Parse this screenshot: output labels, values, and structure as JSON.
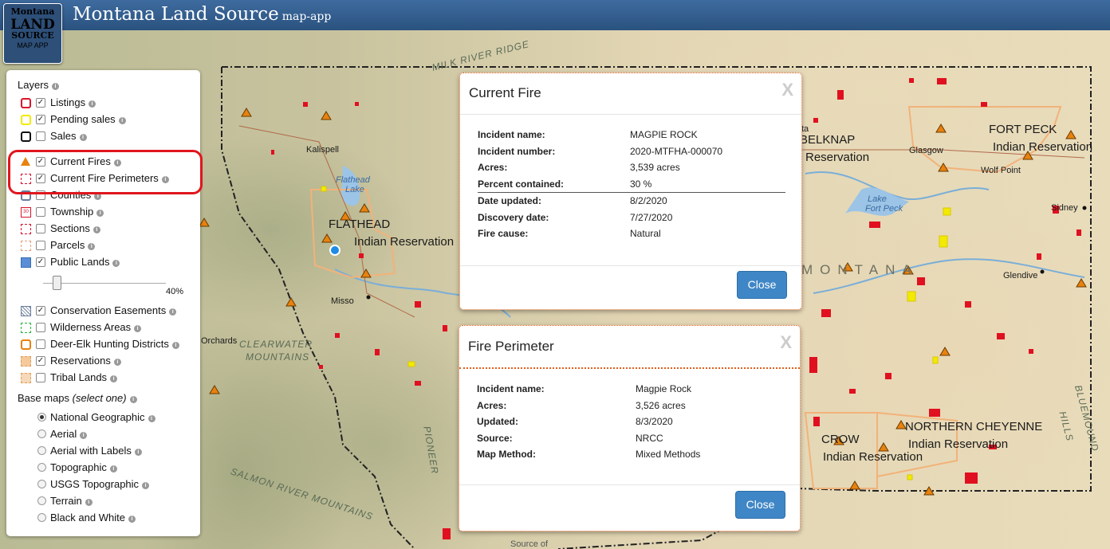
{
  "app": {
    "title": "Montana Land Source",
    "subtitle": "map-app",
    "logo": {
      "line1": "Montana",
      "line2": "LAND",
      "line3": "SOURCE",
      "line4": "MAP APP"
    }
  },
  "layers_panel": {
    "title": "Layers",
    "layers": [
      {
        "label": "Listings",
        "checked": true,
        "symbol_color": "#d9142b"
      },
      {
        "label": "Pending sales",
        "checked": true,
        "symbol_color": "#f2ea00"
      },
      {
        "label": "Sales",
        "checked": false,
        "symbol_color": "#111111"
      },
      {
        "label": "Current Fires",
        "checked": true,
        "symbol_color": "#e8820e"
      },
      {
        "label": "Current Fire Perimeters",
        "checked": true,
        "symbol_color": "#d9142b"
      },
      {
        "label": "Counties",
        "checked": false,
        "symbol_color": "#6a7d9a"
      },
      {
        "label": "Township",
        "checked": false,
        "symbol_color": "#d9142b",
        "symbol_text": "30"
      },
      {
        "label": "Sections",
        "checked": false,
        "symbol_color": "#d9142b"
      },
      {
        "label": "Parcels",
        "checked": false,
        "symbol_color": "#e0a080"
      },
      {
        "label": "Public Lands",
        "checked": true,
        "symbol_color": "#5a8fd8"
      },
      {
        "label": "Conservation Easements",
        "checked": true,
        "symbol_color": "#6a7d9a"
      },
      {
        "label": "Wilderness Areas",
        "checked": false,
        "symbol_color": "#2ab040"
      },
      {
        "label": "Deer-Elk Hunting Districts",
        "checked": false,
        "symbol_color": "#e8820e"
      },
      {
        "label": "Reservations",
        "checked": true,
        "symbol_color": "#f5c99a"
      },
      {
        "label": "Tribal Lands",
        "checked": false,
        "symbol_color": "#f5d9b8"
      }
    ],
    "opacity": {
      "value": 40,
      "label": "40%"
    },
    "base_maps_title": "Base maps",
    "base_maps_hint": "(select one)",
    "base_maps": [
      {
        "label": "National Geographic",
        "selected": true
      },
      {
        "label": "Aerial",
        "selected": false
      },
      {
        "label": "Aerial with Labels",
        "selected": false
      },
      {
        "label": "Topographic",
        "selected": false
      },
      {
        "label": "USGS Topographic",
        "selected": false
      },
      {
        "label": "Terrain",
        "selected": false
      },
      {
        "label": "Black and White",
        "selected": false
      }
    ]
  },
  "popups": {
    "current_fire": {
      "title": "Current Fire",
      "close_x": "X",
      "fields": [
        {
          "key": "Incident name:",
          "value": "MAGPIE ROCK"
        },
        {
          "key": "Incident number:",
          "value": "2020-MTFHA-000070"
        },
        {
          "key": "Acres:",
          "value": "3,539 acres"
        },
        {
          "key": "Percent contained:",
          "value": "30 %"
        },
        {
          "key": "Date updated:",
          "value": "8/2/2020"
        },
        {
          "key": "Discovery date:",
          "value": "7/27/2020"
        },
        {
          "key": "Fire cause:",
          "value": "Natural"
        }
      ],
      "close_button": "Close"
    },
    "fire_perimeter": {
      "title": "Fire Perimeter",
      "close_x": "X",
      "fields": [
        {
          "key": "Incident name:",
          "value": "Magpie Rock"
        },
        {
          "key": "Acres:",
          "value": "3,526 acres"
        },
        {
          "key": "Updated:",
          "value": "8/3/2020"
        },
        {
          "key": "Source:",
          "value": "NRCC"
        },
        {
          "key": "Map Method:",
          "value": "Mixed Methods"
        }
      ],
      "close_button": "Close"
    }
  },
  "map_labels": {
    "flathead_res": "FLATHEAD",
    "flathead_res_sub": "Indian Reservation",
    "belknap_res": "BELKNAP",
    "belknap_res_sub": "Reservation",
    "fort_peck_res": "FORT PECK",
    "fort_peck_res_sub": "Indian Reservation",
    "crow_res": "CROW",
    "crow_res_sub": "Indian Reservation",
    "n_cheyenne_res": "NORTHERN CHEYENNE",
    "n_cheyenne_res_sub": "Indian Reservation",
    "kalispell": "Kalispell",
    "missoula": "Misso",
    "glasgow": "Glasgow",
    "wolf_point": "Wolf Point",
    "sidney": "Sidney",
    "glendive": "Glendive",
    "orchards": "Orchards",
    "flathead_lake_1": "Flathead",
    "flathead_lake_2": "Lake",
    "fort_peck_lake_1": "Lake",
    "fort_peck_lake_2": "Fort Peck",
    "milk_river_ridge": "MILK RIVER RIDGE",
    "clearwater_1": "CLEARWATER",
    "clearwater_2": "MOUNTAINS",
    "salmon_river": "SALMON RIVER MOUNTAINS",
    "pioneer": "PIONEER",
    "montana": "MONTANA",
    "bluemound": "BLUEMOUND",
    "hills": "HILLS",
    "ta": "ta",
    "source": "Source of"
  },
  "colors": {
    "header": "#2f5a8a",
    "accent_button": "#3f86c6",
    "highlight_ring": "#e0161e",
    "fire_marker": "#e8820e",
    "parcel_red": "#e01020",
    "pending_yellow": "#f2ea00"
  }
}
